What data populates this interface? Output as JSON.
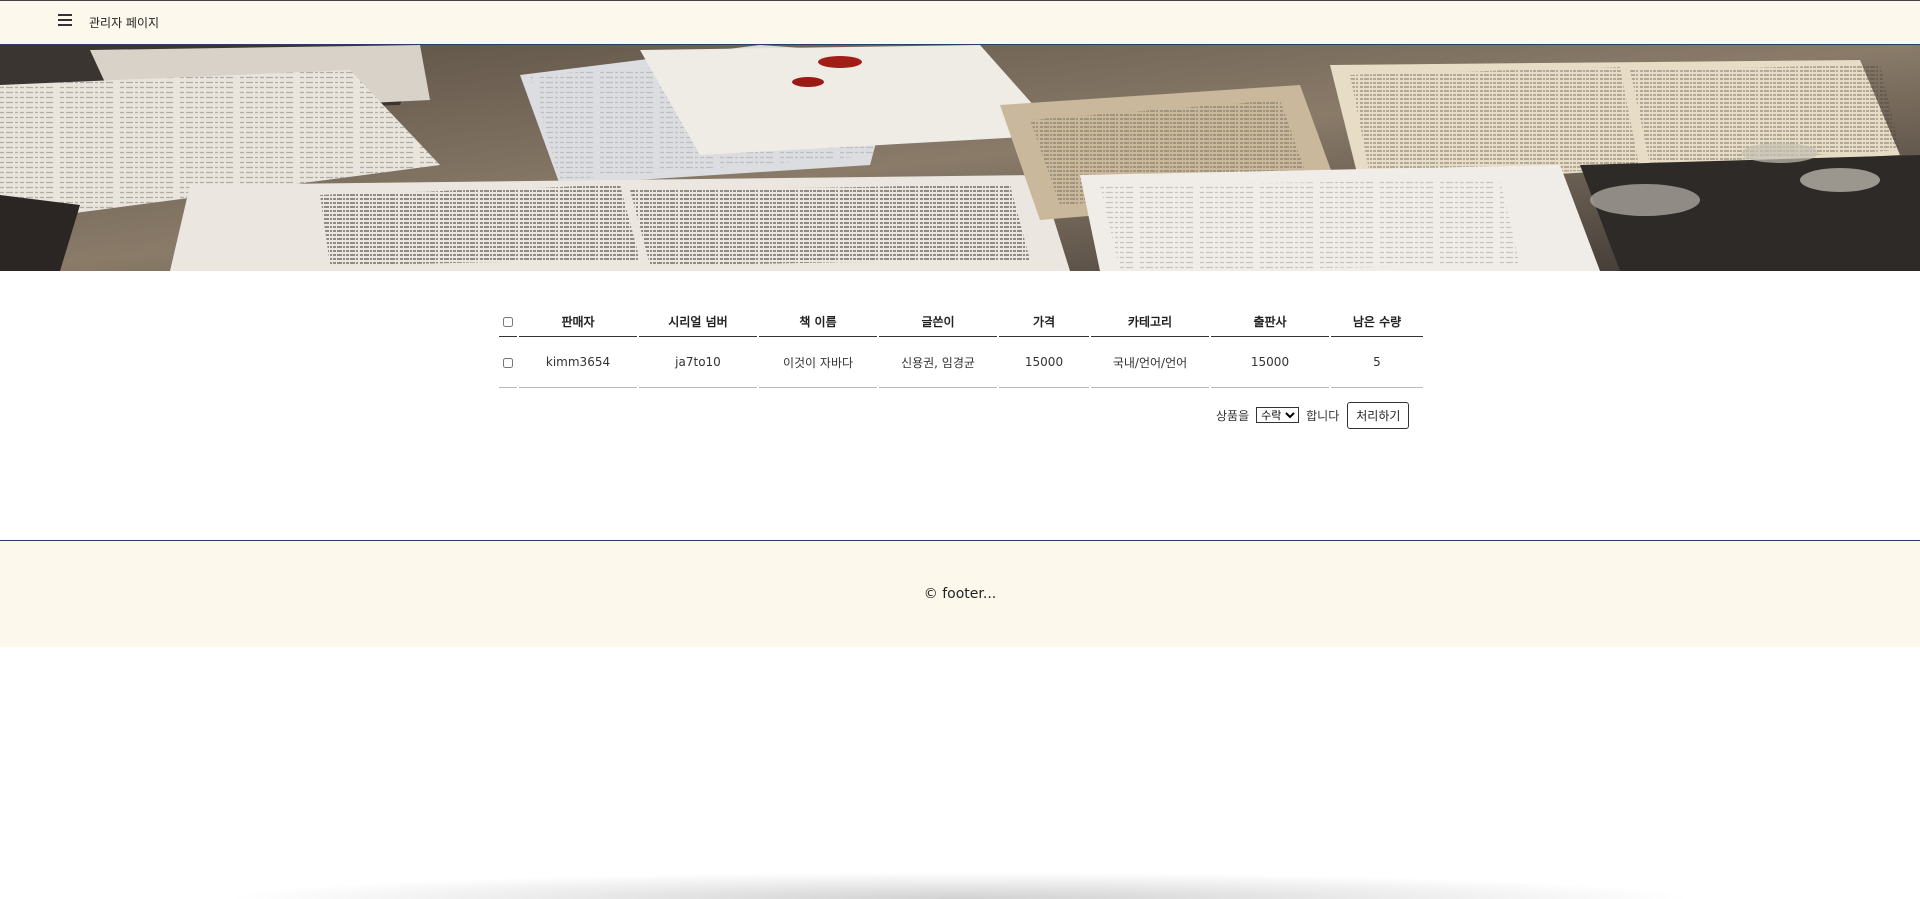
{
  "header": {
    "menu_icon": "hamburger-menu-icon",
    "title": "관리자 페이지"
  },
  "hero": {
    "image": "old-letters-and-books-banner"
  },
  "table": {
    "columns": [
      "판매자",
      "시리얼 넘버",
      "책 이름",
      "글쓴이",
      "가격",
      "카테고리",
      "출판사",
      "남은 수량"
    ],
    "rows": [
      {
        "seller": "kimm3654",
        "serial": "ja7to10",
        "book_name": "이것이 자바다",
        "author": "신용권, 임경균",
        "price": "15000",
        "category": "국내/언어/언어",
        "publisher": "15000",
        "remaining": "5",
        "checked": false
      }
    ]
  },
  "action": {
    "prefix": "상품을",
    "selected_option": "수락",
    "suffix": "합니다",
    "button_label": "처리하기"
  },
  "footer": {
    "text": "© footer..."
  },
  "colors": {
    "header_bg": "#fdf8ec",
    "footer_bg": "#fdf8ec",
    "divider": "#2a3d6b"
  }
}
